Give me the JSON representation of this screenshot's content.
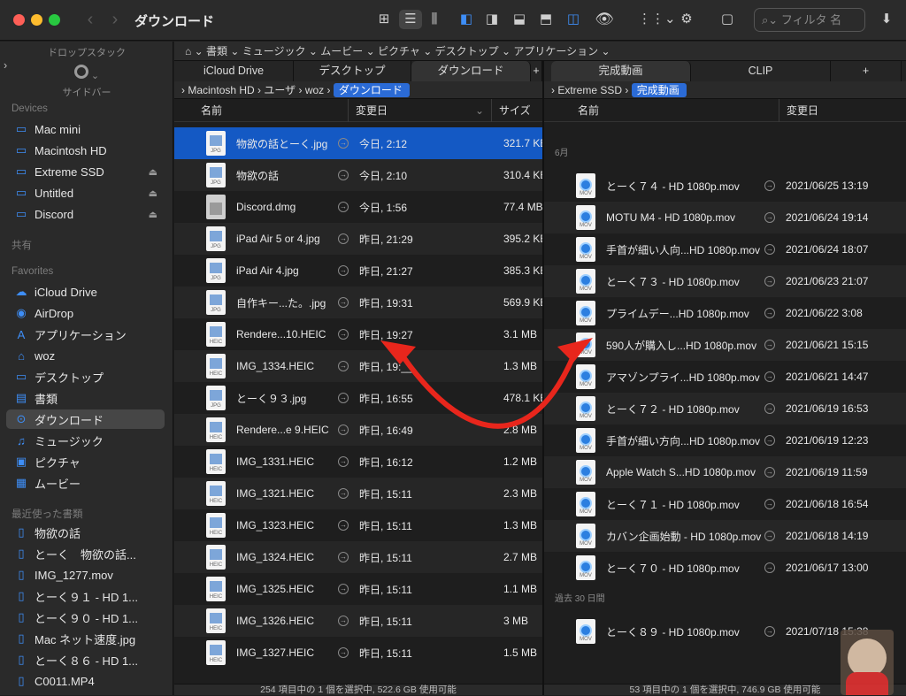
{
  "window": {
    "title": "ダウンロード"
  },
  "toolbar": {
    "search_placeholder": "フィルタ 名"
  },
  "pathbar": {
    "items": [
      "書類",
      "ミュージック",
      "ムービー",
      "ピクチャ",
      "デスクトップ",
      "アプリケーション"
    ]
  },
  "sidebar": {
    "dropstack_label": "ドロップスタック",
    "sidebar_label": "サイドバー",
    "sections": {
      "devices": "Devices",
      "shared": "共有",
      "favorites": "Favorites",
      "recent": "最近使った書類"
    },
    "devices": [
      "Mac mini",
      "Macintosh HD",
      "Extreme SSD",
      "Untitled",
      "Discord"
    ],
    "favorites": [
      "iCloud Drive",
      "AirDrop",
      "アプリケーション",
      "woz",
      "デスクトップ",
      "書類",
      "ダウンロード",
      "ミュージック",
      "ピクチャ",
      "ムービー"
    ],
    "recent": [
      "物欲の話",
      "とーく　物欲の話...",
      "IMG_1277.mov",
      "とーく９１ - HD 1...",
      "とーく９０ - HD 1...",
      "Mac ネット速度.jpg",
      "とーく８６ - HD 1...",
      "C0011.MP4"
    ]
  },
  "left_pane": {
    "tabs": [
      "iCloud Drive",
      "デスクトップ",
      "ダウンロード",
      "+"
    ],
    "crumbs": [
      "Macintosh HD",
      "ユーザ",
      "woz"
    ],
    "crumb_current": "ダウンロード",
    "headers": {
      "name": "名前",
      "date": "変更日",
      "size": "サイズ"
    },
    "files": [
      {
        "name": "物欲の話とーく.jpg",
        "date": "今日, 2:12",
        "size": "321.7 KB",
        "ext": "JPG",
        "kind": "img"
      },
      {
        "name": "物欲の話",
        "date": "今日, 2:10",
        "size": "310.4 KB",
        "ext": "JPG",
        "kind": "img"
      },
      {
        "name": "Discord.dmg",
        "date": "今日, 1:56",
        "size": "77.4 MB",
        "ext": "",
        "kind": "dmg"
      },
      {
        "name": "iPad Air 5 or 4.jpg",
        "date": "昨日, 21:29",
        "size": "395.2 KB",
        "ext": "JPG",
        "kind": "img"
      },
      {
        "name": "iPad Air 4.jpg",
        "date": "昨日, 21:27",
        "size": "385.3 KB",
        "ext": "JPG",
        "kind": "img"
      },
      {
        "name": "自作キー...た。.jpg",
        "date": "昨日, 19:31",
        "size": "569.9 KB",
        "ext": "JPG",
        "kind": "img"
      },
      {
        "name": "Rendere...10.HEIC",
        "date": "昨日, 19:27",
        "size": "3.1 MB",
        "ext": "HEIC",
        "kind": "img"
      },
      {
        "name": "IMG_1334.HEIC",
        "date": "昨日, 19:__",
        "size": "1.3 MB",
        "ext": "HEIC",
        "kind": "img"
      },
      {
        "name": "とーく９３.jpg",
        "date": "昨日, 16:55",
        "size": "478.1 KB",
        "ext": "JPG",
        "kind": "img"
      },
      {
        "name": "Rendere...e 9.HEIC",
        "date": "昨日, 16:49",
        "size": "2.8 MB",
        "ext": "HEIC",
        "kind": "img"
      },
      {
        "name": "IMG_1331.HEIC",
        "date": "昨日, 16:12",
        "size": "1.2 MB",
        "ext": "HEIC",
        "kind": "img"
      },
      {
        "name": "IMG_1321.HEIC",
        "date": "昨日, 15:11",
        "size": "2.3 MB",
        "ext": "HEIC",
        "kind": "img"
      },
      {
        "name": "IMG_1323.HEIC",
        "date": "昨日, 15:11",
        "size": "1.3 MB",
        "ext": "HEIC",
        "kind": "img"
      },
      {
        "name": "IMG_1324.HEIC",
        "date": "昨日, 15:11",
        "size": "2.7 MB",
        "ext": "HEIC",
        "kind": "img"
      },
      {
        "name": "IMG_1325.HEIC",
        "date": "昨日, 15:11",
        "size": "1.1 MB",
        "ext": "HEIC",
        "kind": "img"
      },
      {
        "name": "IMG_1326.HEIC",
        "date": "昨日, 15:11",
        "size": "3 MB",
        "ext": "HEIC",
        "kind": "img"
      },
      {
        "name": "IMG_1327.HEIC",
        "date": "昨日, 15:11",
        "size": "1.5 MB",
        "ext": "HEIC",
        "kind": "img"
      }
    ],
    "status": "254 項目中の 1 個を選択中, 522.6 GB 使用可能"
  },
  "right_pane": {
    "tabs": [
      "完成動画",
      "CLIP",
      "+"
    ],
    "crumbs": [
      "Extreme SSD"
    ],
    "crumb_current": "完成動画",
    "headers": {
      "name": "名前",
      "date": "変更日"
    },
    "group1": "6月",
    "group2": "過去 30 日間",
    "files": [
      {
        "name": "とーく７４ - HD 1080p.mov",
        "date": "2021/06/25 13:19"
      },
      {
        "name": "MOTU M4 - HD 1080p.mov",
        "date": "2021/06/24 19:14"
      },
      {
        "name": "手首が細い人向...HD 1080p.mov",
        "date": "2021/06/24 18:07"
      },
      {
        "name": "とーく７３ - HD 1080p.mov",
        "date": "2021/06/23 21:07"
      },
      {
        "name": "プライムデー...HD 1080p.mov",
        "date": "2021/06/22 3:08"
      },
      {
        "name": "590人が購入し...HD 1080p.mov",
        "date": "2021/06/21 15:15"
      },
      {
        "name": "アマゾンプライ...HD 1080p.mov",
        "date": "2021/06/21 14:47"
      },
      {
        "name": "とーく７２ - HD 1080p.mov",
        "date": "2021/06/19 16:53"
      },
      {
        "name": "手首が細い方向...HD 1080p.mov",
        "date": "2021/06/19 12:23"
      },
      {
        "name": "Apple Watch S...HD 1080p.mov",
        "date": "2021/06/19 11:59"
      },
      {
        "name": "とーく７１ - HD 1080p.mov",
        "date": "2021/06/18 16:54"
      },
      {
        "name": "カバン企画始動 - HD 1080p.mov",
        "date": "2021/06/18 14:19"
      },
      {
        "name": "とーく７０ - HD 1080p.mov",
        "date": "2021/06/17 13:00"
      }
    ],
    "recent_files": [
      {
        "name": "とーく８９ - HD 1080p.mov",
        "date": "2021/07/18 15:38"
      }
    ],
    "status": "53 項目中の 1 個を選択中, 746.9 GB 使用可能"
  },
  "annotation": {
    "arrow_color": "#e8261c"
  }
}
